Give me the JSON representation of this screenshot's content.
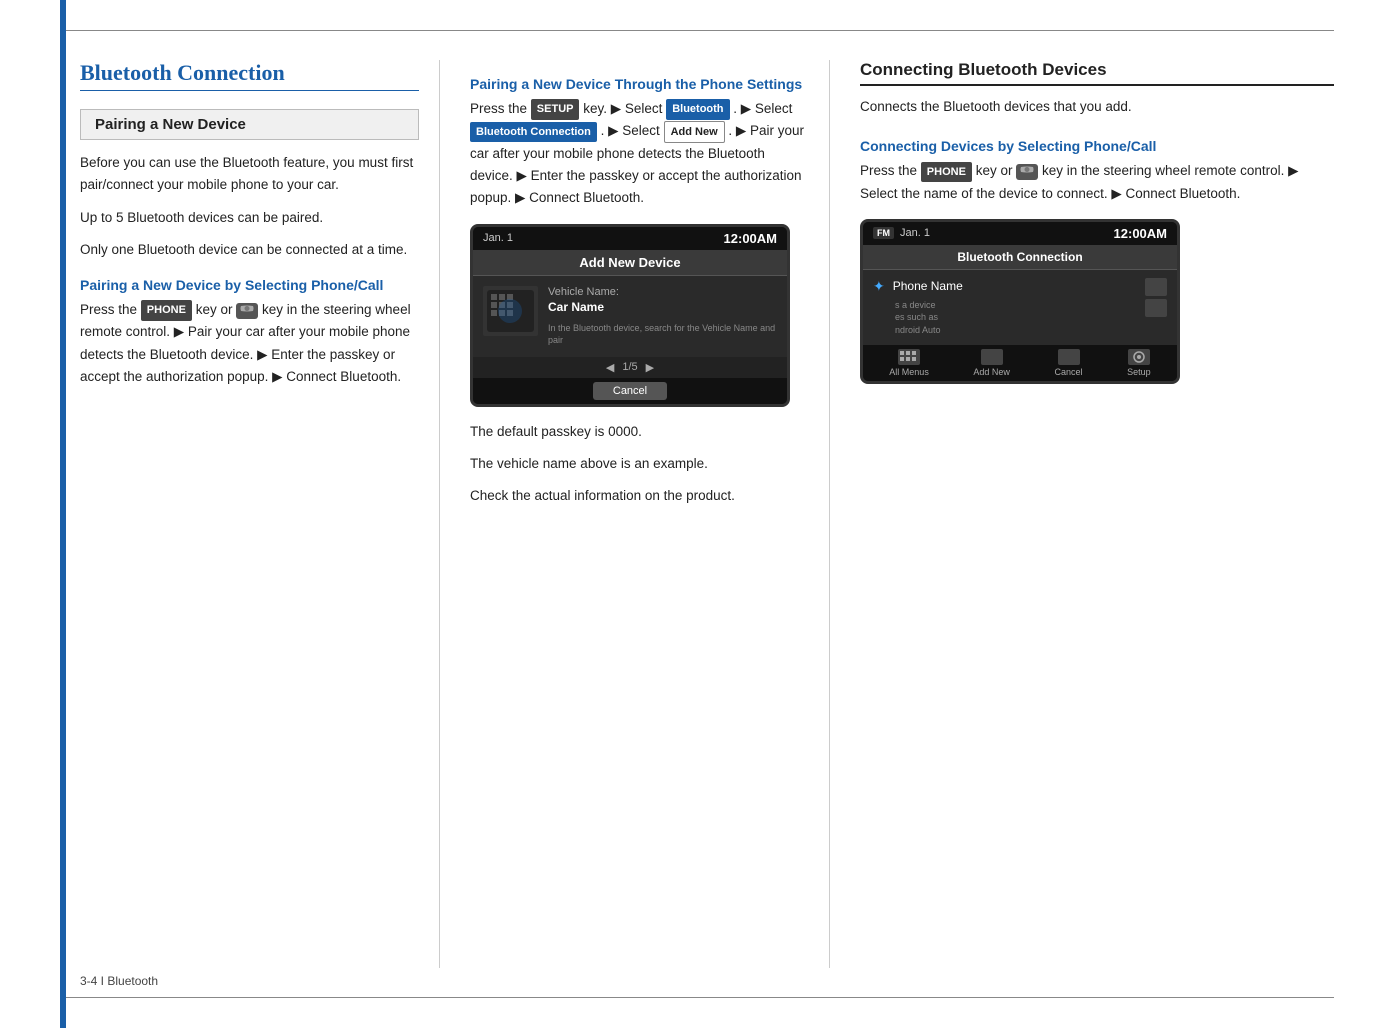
{
  "page": {
    "page_number": "3-4 I Bluetooth"
  },
  "left_col": {
    "main_title": "Bluetooth Connection",
    "section1": {
      "box_title": "Pairing a New Device",
      "para1": "Before you can use the Bluetooth feature, you must first pair/connect your mobile phone to your car.",
      "para2": "Up to 5 Bluetooth devices can be paired.",
      "para3": "Only one Bluetooth device can be connected at a time."
    },
    "section2": {
      "title": "Pairing a New Device by Selecting Phone/Call",
      "text": "Press the",
      "phone_badge": "PHONE",
      "text2": "key or",
      "text3": "key in the steering wheel remote  control. ▶ Pair your car after your mobile phone detects the Bluetooth device. ▶ Enter the passkey or accept the authorization popup. ▶ Connect Bluetooth."
    }
  },
  "mid_col": {
    "section1": {
      "title": "Pairing a New Device Through the Phone Settings",
      "text1": "Press the",
      "setup_badge": "SETUP",
      "text2": "key. ▶ Select",
      "bluetooth_badge": "Bluetooth",
      "text3": ". ▶ Select",
      "bt_conn_badge": "Bluetooth Connection",
      "text4": ". ▶ Select",
      "add_new_badge": "Add New",
      "text5": ". ▶ Pair your car after your mobile phone detects the Bluetooth device. ▶ Enter the passkey or accept the authorization popup. ▶ Connect Bluetooth."
    },
    "screen1": {
      "date": "Jan.  1",
      "time": "12:00AM",
      "title": "Add New Device",
      "vehicle_label": "Vehicle Name:",
      "vehicle_name": "Car Name",
      "info_text": "In the Bluetooth device, search for the Vehicle Name and pair",
      "pagination": "1/5",
      "cancel": "Cancel"
    },
    "caption1": "The default passkey is 0000.",
    "caption2": "The vehicle name above is an example.",
    "caption3": "Check the actual information on the product."
  },
  "right_col": {
    "section1": {
      "title": "Connecting Bluetooth Devices",
      "text": "Connects the Bluetooth devices that you add."
    },
    "section2": {
      "title": "Connecting Devices by Selecting Phone/Call",
      "text1": "Press the",
      "phone_badge": "PHONE",
      "text2": "key or",
      "text3": "key in the steering wheel remote  control. ▶ Select the name of the device to connect. ▶ Connect Bluetooth."
    },
    "screen2": {
      "date": "Jan.  1",
      "time": "12:00AM",
      "fm_badge": "FM",
      "title": "Bluetooth Connection",
      "phone_name": "Phone Name",
      "device_hint1": "s a device",
      "device_hint2": "es such as",
      "device_hint3": "ndroid Auto",
      "footer": {
        "all_menus": "All Menus",
        "add_new": "Add New",
        "cancel": "Cancel",
        "setup": "Setup"
      }
    }
  },
  "icons": {
    "arrow_right": "▶",
    "bluetooth_char": "✦",
    "phone_unicode": "📞"
  }
}
